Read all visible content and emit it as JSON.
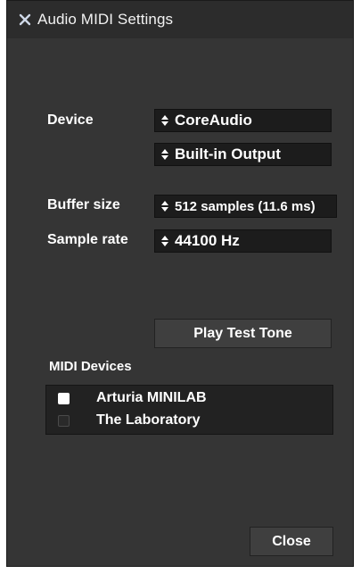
{
  "window": {
    "title": "Audio MIDI Settings"
  },
  "device": {
    "label": "Device",
    "type_value": "CoreAudio",
    "output_value": "Built-in Output"
  },
  "buffer": {
    "label": "Buffer size",
    "value": "512 samples (11.6 ms)"
  },
  "sample_rate": {
    "label": "Sample rate",
    "value": "44100 Hz"
  },
  "test_tone": {
    "label": "Play Test Tone"
  },
  "midi": {
    "label": "MIDI Devices",
    "devices": [
      {
        "name": "Arturia MINILAB",
        "enabled": true
      },
      {
        "name": "The Laboratory",
        "enabled": false
      }
    ]
  },
  "footer": {
    "close_label": "Close"
  },
  "colors": {
    "window_bg": "#353535",
    "combo_bg": "#1c1c1c",
    "text": "#ffffff"
  }
}
